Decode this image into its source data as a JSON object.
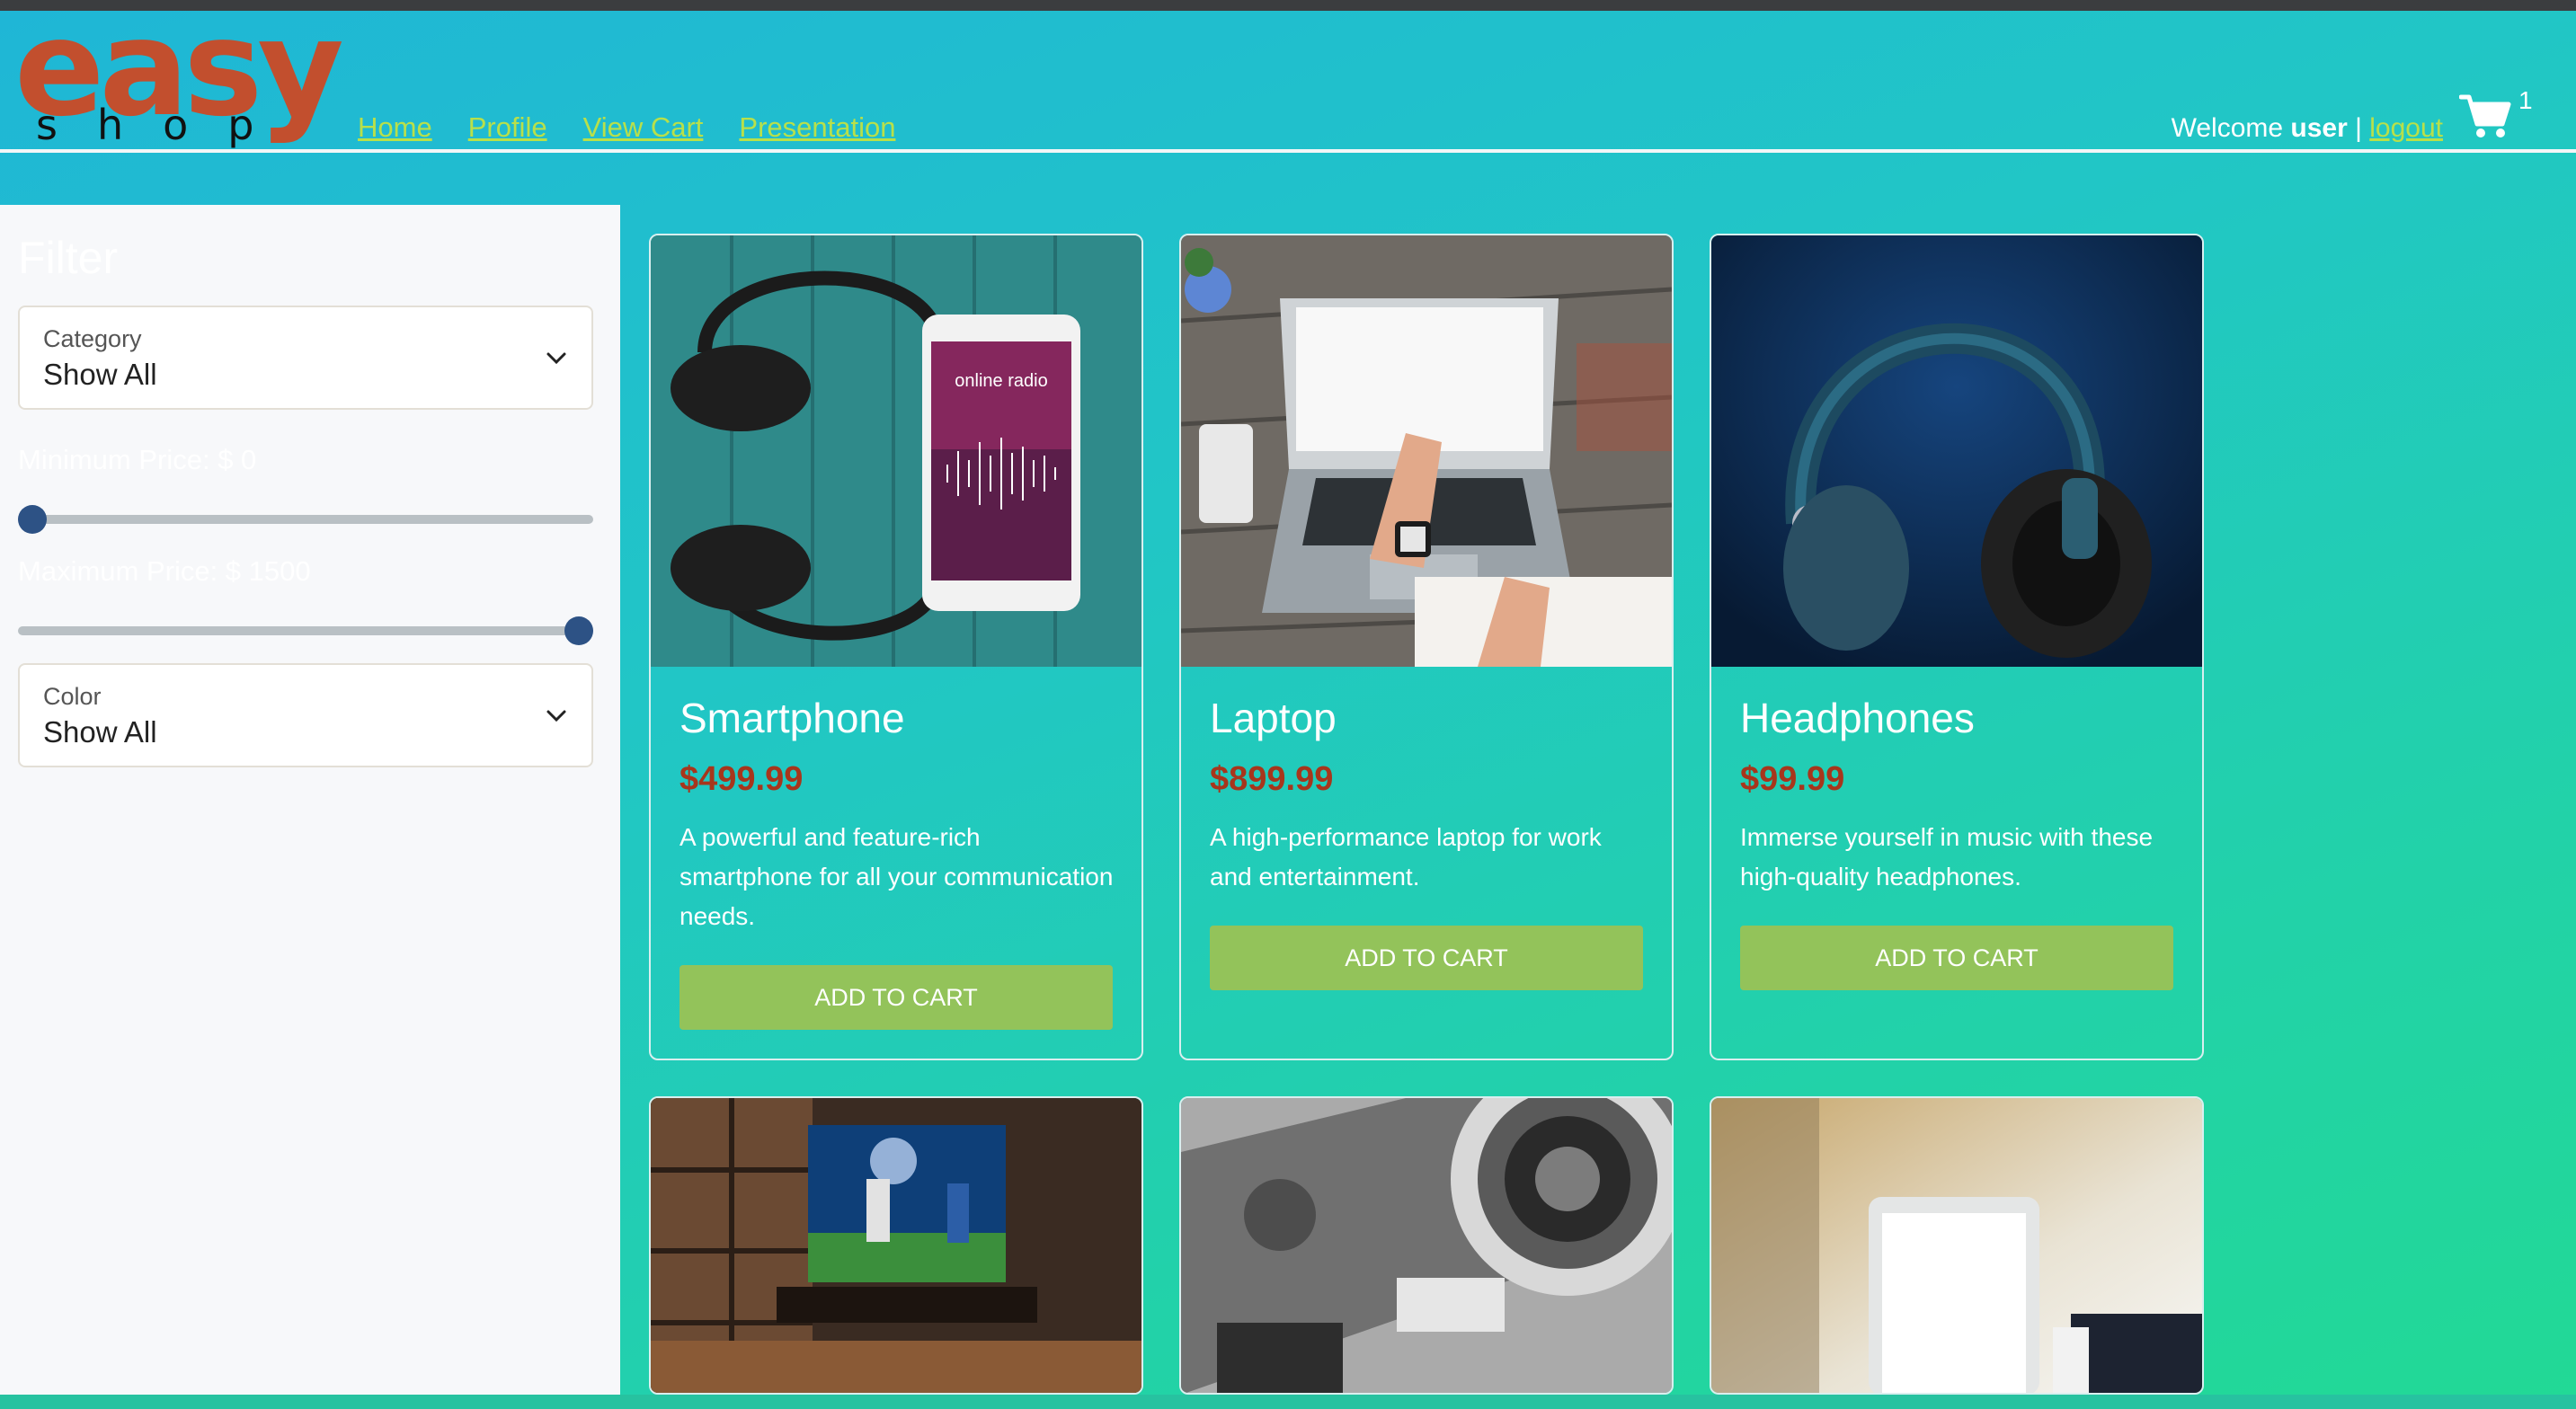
{
  "header": {
    "logo_top": "easy",
    "logo_bottom": "shop",
    "nav": [
      "Home",
      "Profile",
      "View Cart",
      "Presentation"
    ],
    "welcome_prefix": "Welcome ",
    "username": "user",
    "separator": " | ",
    "logout": "logout",
    "cart_count": "1"
  },
  "sidebar": {
    "title": "Filter",
    "category": {
      "label": "Category",
      "value": "Show All"
    },
    "min_price_label": "Minimum Price: $ 0",
    "max_price_label": "Maximum Price: $ 1500",
    "min_price_level": 0,
    "max_price_level": 1,
    "color": {
      "label": "Color",
      "value": "Show All"
    }
  },
  "products": [
    {
      "name": "Smartphone",
      "price": "$499.99",
      "description": "A powerful and feature-rich smartphone for all your communication needs.",
      "button": "ADD TO CART",
      "image_text": "online radio"
    },
    {
      "name": "Laptop",
      "price": "$899.99",
      "description": "A high-performance laptop for work and entertainment.",
      "button": "ADD TO CART"
    },
    {
      "name": "Headphones",
      "price": "$99.99",
      "description": "Immerse yourself in music with these high-quality headphones.",
      "button": "ADD TO CART"
    }
  ],
  "colors": {
    "accent_green": "#93c35a",
    "price_red": "#a7361c",
    "logo_orange": "#c24f2e",
    "link_green": "#b8e04a"
  }
}
